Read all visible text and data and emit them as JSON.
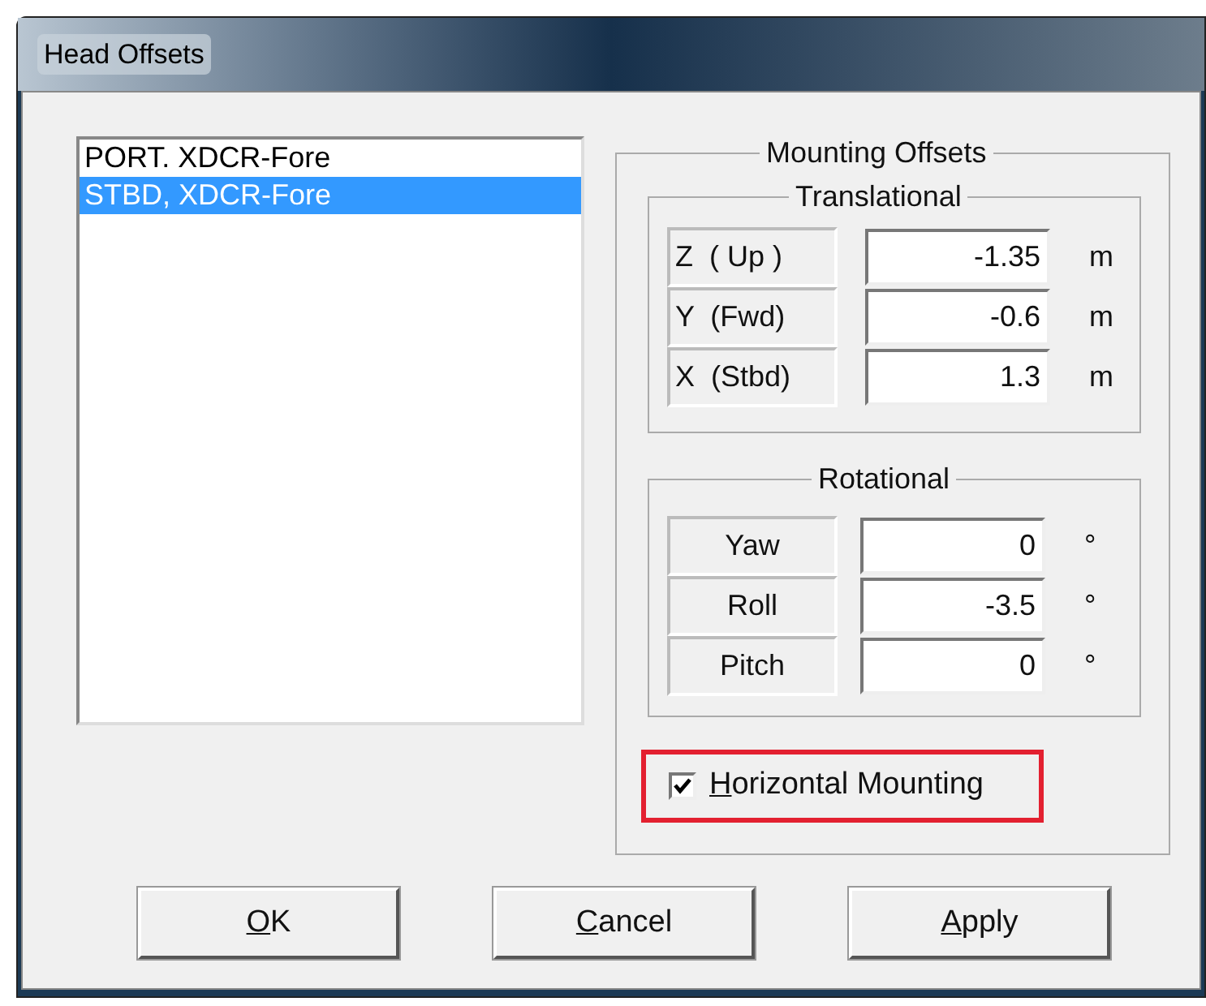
{
  "window": {
    "title": "Head Offsets"
  },
  "heads": [
    {
      "label": "PORT. XDCR-Fore",
      "selected": false
    },
    {
      "label": "STBD, XDCR-Fore",
      "selected": true
    }
  ],
  "mounting_offsets": {
    "title": "Mounting Offsets",
    "translational": {
      "title": "Translational",
      "rows": [
        {
          "label": "Z  ( Up )",
          "value": "-1.35",
          "unit": "m"
        },
        {
          "label": "Y  (Fwd)",
          "value": "-0.6",
          "unit": "m"
        },
        {
          "label": "X  (Stbd)",
          "value": "1.3",
          "unit": "m"
        }
      ]
    },
    "rotational": {
      "title": "Rotational",
      "rows": [
        {
          "label": "Yaw",
          "value": "0",
          "unit": "°"
        },
        {
          "label": "Roll",
          "value": "-3.5",
          "unit": "°"
        },
        {
          "label": "Pitch",
          "value": "0",
          "unit": "°"
        }
      ]
    },
    "horizontal_mounting": {
      "label": "Horizontal Mounting",
      "checked": true
    }
  },
  "buttons": [
    "OK",
    "Cancel",
    "Apply"
  ]
}
